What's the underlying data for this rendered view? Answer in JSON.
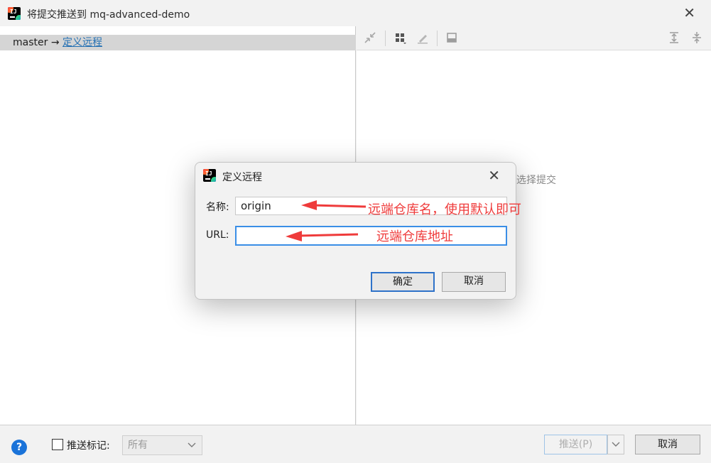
{
  "window": {
    "title": "将提交推送到 mq-advanced-demo",
    "close_glyph": "✕",
    "app_icon_letters": "IJ"
  },
  "left": {
    "source_branch": "master",
    "arrow": "→",
    "remote_link": "定义远程"
  },
  "right": {
    "empty_hint": "选择提交"
  },
  "bottom": {
    "help": "?",
    "push_tags_label": "推送标记:",
    "tags_select_value": "所有",
    "push_button": "推送(P)",
    "cancel_button": "取消"
  },
  "dialog": {
    "title": "定义远程",
    "close_glyph": "✕",
    "name_label": "名称:",
    "name_value": "origin",
    "url_label": "URL:",
    "url_value": "",
    "ok_button": "确定",
    "cancel_button": "取消"
  },
  "annotations": {
    "name_note": "远端仓库名，使用默认即可",
    "url_note": "远端仓库地址",
    "color": "#ef3b3b"
  },
  "icons": [
    "app-icon",
    "close-icon",
    "collapse-icon",
    "group-icon",
    "edit-icon",
    "preview-icon",
    "expand-all-icon",
    "collapse-all-icon",
    "help-icon",
    "chevron-down-icon"
  ]
}
